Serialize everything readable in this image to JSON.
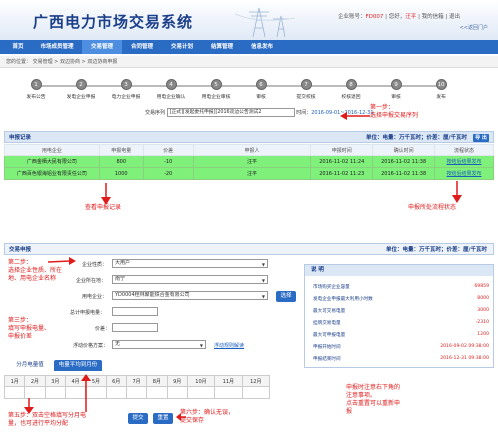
{
  "header": {
    "title": "广西电力市场交易系统",
    "user_label": "企业账号：",
    "user_code": "FD007",
    "greeting": "您好，",
    "user_name": "汪平",
    "links": [
      "我的信箱",
      "退出"
    ],
    "back_link": "<<返回门户"
  },
  "nav": {
    "items": [
      "首页",
      "市场成员管理",
      "交易管理",
      "合同管理",
      "交易计划",
      "结算管理",
      "信息发布"
    ],
    "active_index": 2
  },
  "breadcrumb": "您的位置：  交易管理 > 双边协商 > 双边协商申报",
  "steps": [
    {
      "num": "1",
      "label": "发布公告"
    },
    {
      "num": "2",
      "label": "发电企业申报"
    },
    {
      "num": "3",
      "label": "电力企业申报"
    },
    {
      "num": "4",
      "label": "用电企业确认"
    },
    {
      "num": "5",
      "label": "用电企业审核"
    },
    {
      "num": "6",
      "label": "审核"
    },
    {
      "num": "7",
      "label": "提交校核"
    },
    {
      "num": "8",
      "label": "校核退回"
    },
    {
      "num": "9",
      "label": "审核"
    },
    {
      "num": "10",
      "label": "发布"
    }
  ],
  "sequence": {
    "label": "交易序列",
    "value": "[正式][发起委托申报][2016双边公告测试2",
    "time_label": "时间：",
    "time_value": "2016-09-01~2016-12-31"
  },
  "annotations": {
    "step1_a": "第一步：",
    "step1_b": "选择申报交易序列",
    "view_records": "查看申报记录",
    "status": "申报所处流程状态",
    "step2": [
      "第二步：",
      "选择企业性质、所在",
      "地、用电企业名称"
    ],
    "step3": [
      "第三步：",
      "填写申报电量、",
      "申报价差"
    ],
    "step5": [
      "第五步：双击空格填写分月电",
      "量，也可进行平均分配"
    ],
    "step6": [
      "第六步：确认无误，",
      "提交保存"
    ],
    "notes": [
      "申报时注意右下角的",
      "注意事项。",
      "点击重置可以重新申",
      "报"
    ]
  },
  "records": {
    "title": "申报记录",
    "unit": "单位：电量：万千瓦时；价差：厘/千瓦时",
    "export_label": "导 出",
    "columns": [
      "用电企业",
      "申报电量",
      "价差",
      "申报人",
      "申报时间",
      "确认时间",
      "流程状态"
    ],
    "rows": [
      [
        "广西金栖大民有限公司",
        "800",
        "-10",
        "汪平",
        "2016-11-02 11:24",
        "2016-11-02 11:38",
        "按结后结果发布"
      ],
      [
        "广西百色银海铝业有限责任公司",
        "1000",
        "-20",
        "汪平",
        "2016-11-02 11:23",
        "2016-11-02 11:38",
        "按结后结果发布"
      ]
    ]
  },
  "form": {
    "title": "交易申报",
    "unit": "单位：电量：万千瓦时；价差：厘/千瓦时",
    "nature_label": "企业性质：",
    "nature_value": "大用户",
    "region_label": "企业所在地：",
    "region_value": "南宁",
    "company_label": "用电企业：",
    "company_value": "YD0004桂林聚能铁合金有限公司",
    "select_btn": "选择",
    "quantity_label": "总计申报电量：",
    "quantity_value": "",
    "price_label": "价差：",
    "price_value": "",
    "fluct_label": "浮动价格方案：",
    "fluct_value": "无",
    "fluct_link": "浮动规则解读",
    "submit": "提交",
    "reset": "重置"
  },
  "tabs": [
    "分月电量值",
    "电量平均到月份"
  ],
  "months": [
    "1月",
    "2月",
    "3月",
    "4月",
    "5月",
    "6月",
    "7月",
    "8月",
    "9月",
    "10月",
    "11月",
    "12月"
  ],
  "explain": {
    "title": "说 明",
    "rows": [
      {
        "label": "市场购买企业容量",
        "value": "69859"
      },
      {
        "label": "发电企业申报最大利用小时数",
        "value": "8000"
      },
      {
        "label": "最大可交易电量",
        "value": "3000"
      },
      {
        "label": "挂牌交易电量",
        "value": "-2310"
      },
      {
        "label": "最大可申报电量",
        "value": "1200"
      },
      {
        "label": "申报开始时间",
        "value": "2016-09-02 09:38:00"
      },
      {
        "label": "申报结束时间",
        "value": "2016-12-31 09:38:00"
      }
    ]
  },
  "colors": {
    "nav": "#2a6bc4",
    "row_green": "#7ff07a",
    "annotation": "#e01b1b"
  }
}
